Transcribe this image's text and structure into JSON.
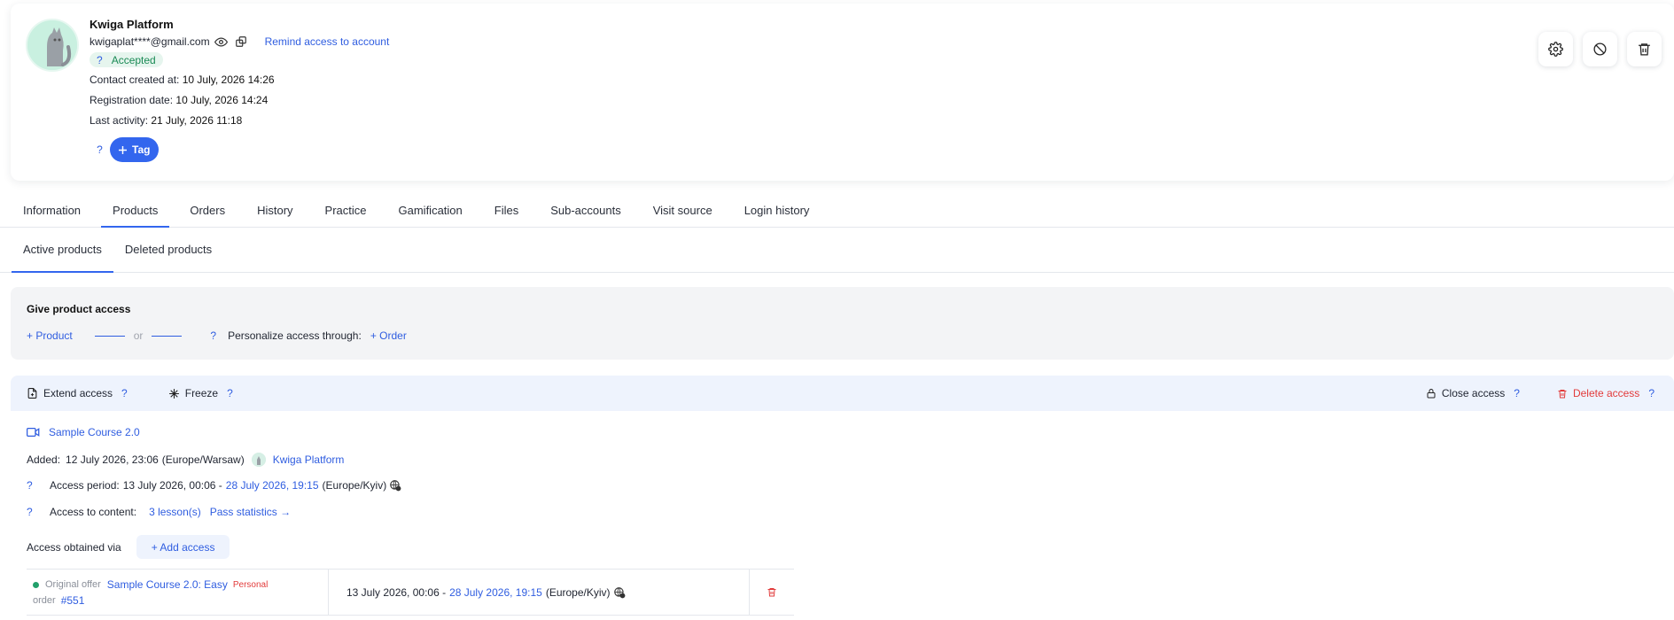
{
  "profile": {
    "name": "Kwiga Platform",
    "email": "kwigaplat****@gmail.com",
    "remind_label": "Remind access to account",
    "status_q": "?",
    "status": "Accepted",
    "created_label": "Contact created at:",
    "created_value": "10 July, 2026 14:26",
    "registration_label": "Registration date:",
    "registration_value": "10 July, 2026 14:24",
    "last_activity_label": "Last activity:",
    "last_activity_value": "21 July, 2026 11:18",
    "tag_help": "?",
    "tag_button": "Tag"
  },
  "top_actions": [
    "settings-icon",
    "block-icon",
    "trash-icon"
  ],
  "tabs": [
    {
      "label": "Information"
    },
    {
      "label": "Products"
    },
    {
      "label": "Orders"
    },
    {
      "label": "History"
    },
    {
      "label": "Practice"
    },
    {
      "label": "Gamification"
    },
    {
      "label": "Files"
    },
    {
      "label": "Sub-accounts"
    },
    {
      "label": "Visit source"
    },
    {
      "label": "Login history"
    }
  ],
  "active_tab": "Products",
  "subtabs": [
    {
      "label": "Active products"
    },
    {
      "label": "Deleted products"
    }
  ],
  "give_access": {
    "title": "Give product access",
    "product_link": "+ Product",
    "or": "or",
    "help": "?",
    "personalize_label": "Personalize access through:",
    "order_link": "+ Order"
  },
  "toolbar": {
    "extend": "Extend access",
    "freeze": "Freeze",
    "close": "Close access",
    "delete": "Delete access",
    "help": "?"
  },
  "product": {
    "name": "Sample Course 2.0",
    "added_label": "Added:",
    "added_value": "12 July 2026, 23:06",
    "added_tz": "(Europe/Warsaw)",
    "added_by": "Kwiga Platform",
    "access_period_label": "Access period:",
    "access_period_start": "13 July 2026, 00:06 -",
    "access_period_end": "28 July 2026, 19:15",
    "access_period_tz": "(Europe/Kyiv)",
    "content_label": "Access to content:",
    "lessons_link": "3 lesson(s)",
    "stats_link": "Pass statistics →",
    "obtained_label": "Access obtained via",
    "add_access": "+ Add access",
    "help": "?"
  },
  "access_rows": [
    {
      "offer_label": "Original offer",
      "offer_name": "Sample Course 2.0: Easy",
      "offer_type": "Personal",
      "order_label": "order",
      "order_number": "#551",
      "period_start": "13 July 2026, 00:06 -",
      "period_end": "28 July 2026, 19:15",
      "period_tz": "(Europe/Kyiv)"
    }
  ],
  "colors": {
    "accent": "#3366ee",
    "link": "#2f5de0",
    "danger": "#e23b3b",
    "success": "#22a06b"
  }
}
